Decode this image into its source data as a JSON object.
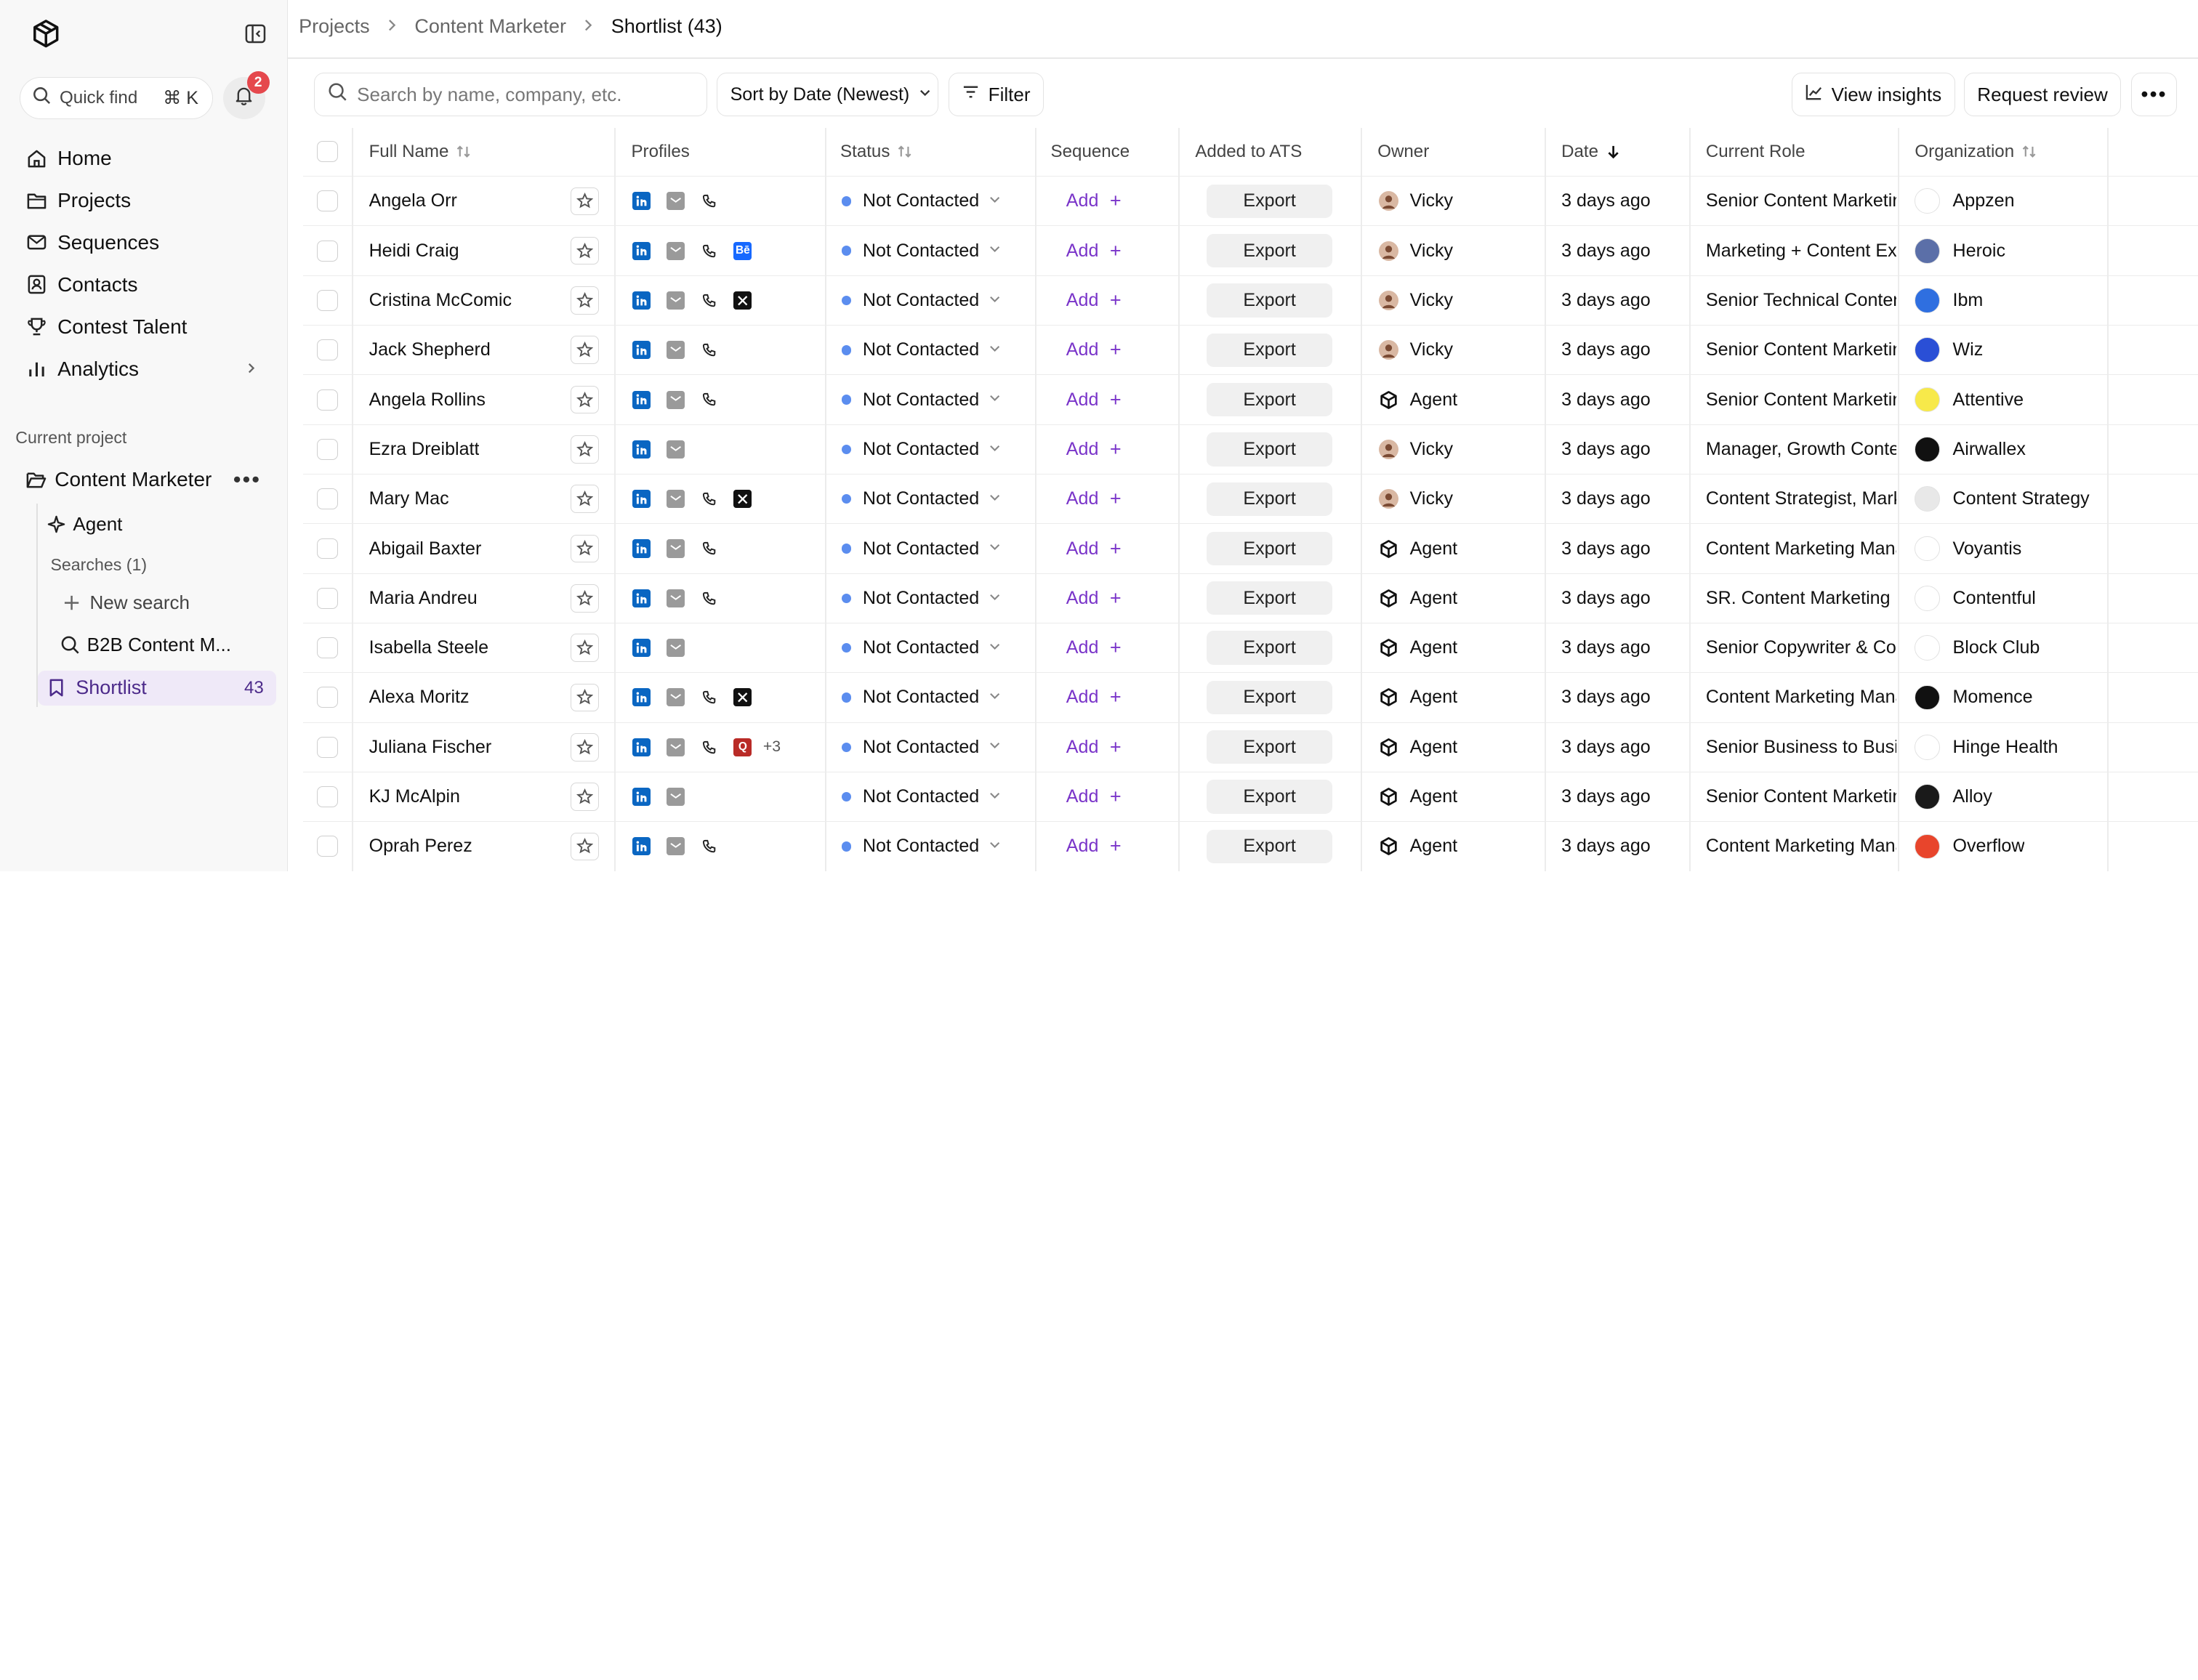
{
  "sidebar": {
    "quickfind_label": "Quick find",
    "quickfind_shortcut": "⌘ K",
    "notification_count": "2",
    "nav": [
      {
        "label": "Home",
        "icon": "home-icon"
      },
      {
        "label": "Projects",
        "icon": "folder-icon"
      },
      {
        "label": "Sequences",
        "icon": "mail-icon"
      },
      {
        "label": "Contacts",
        "icon": "contact-card-icon"
      },
      {
        "label": "Contest Talent",
        "icon": "trophy-icon"
      },
      {
        "label": "Analytics",
        "icon": "bar-chart-icon"
      }
    ],
    "current_project_label": "Current project",
    "project_name": "Content Marketer",
    "agent_label": "Agent",
    "searches_label": "Searches (1)",
    "new_search_label": "New search",
    "search_item_label": "B2B Content M...",
    "shortlist_label": "Shortlist",
    "shortlist_count": "43"
  },
  "breadcrumb": {
    "items": [
      "Projects",
      "Content Marketer"
    ],
    "current": "Shortlist (43)"
  },
  "toolbar": {
    "search_placeholder": "Search by name, company, etc.",
    "sort_label": "Sort by Date (Newest)",
    "filter_label": "Filter",
    "insights_label": "View insights",
    "review_label": "Request review"
  },
  "table": {
    "headers": {
      "full_name": "Full Name",
      "profiles": "Profiles",
      "status": "Status",
      "sequence": "Sequence",
      "added_to_ats": "Added to ATS",
      "owner": "Owner",
      "date": "Date",
      "current_role": "Current Role",
      "organization": "Organization"
    },
    "add_label": "Add",
    "export_label": "Export",
    "rows": [
      {
        "name": "Angela Orr",
        "profiles": [
          "linkedin",
          "mail",
          "phone"
        ],
        "status": "Not Contacted",
        "owner": "Vicky",
        "date": "3 days ago",
        "role": "Senior Content Marketing",
        "org": "Appzen",
        "org_color": "#ffffff"
      },
      {
        "name": "Heidi Craig",
        "profiles": [
          "linkedin",
          "mail",
          "phone",
          "behance"
        ],
        "status": "Not Contacted",
        "owner": "Vicky",
        "date": "3 days ago",
        "role": "Marketing + Content Exp",
        "org": "Heroic",
        "org_color": "#5b6fa8"
      },
      {
        "name": "Cristina McComic",
        "profiles": [
          "linkedin",
          "mail",
          "phone",
          "x"
        ],
        "status": "Not Contacted",
        "owner": "Vicky",
        "date": "3 days ago",
        "role": "Senior Technical Content",
        "org": "Ibm",
        "org_color": "#2f6fe0"
      },
      {
        "name": "Jack Shepherd",
        "profiles": [
          "linkedin",
          "mail",
          "phone"
        ],
        "status": "Not Contacted",
        "owner": "Vicky",
        "date": "3 days ago",
        "role": "Senior Content Marketing",
        "org": "Wiz",
        "org_color": "#2a4fd6"
      },
      {
        "name": "Angela Rollins",
        "profiles": [
          "linkedin",
          "mail",
          "phone"
        ],
        "status": "Not Contacted",
        "owner": "Agent",
        "date": "3 days ago",
        "role": "Senior Content Marketing",
        "org": "Attentive",
        "org_color": "#f7e94a"
      },
      {
        "name": "Ezra Dreiblatt",
        "profiles": [
          "linkedin",
          "mail"
        ],
        "status": "Not Contacted",
        "owner": "Vicky",
        "date": "3 days ago",
        "role": "Manager, Growth Conten",
        "org": "Airwallex",
        "org_color": "#111111"
      },
      {
        "name": "Mary Mac",
        "profiles": [
          "linkedin",
          "mail",
          "phone",
          "x"
        ],
        "status": "Not Contacted",
        "owner": "Vicky",
        "date": "3 days ago",
        "role": "Content Strategist, Marke",
        "org": "Content Strategy",
        "org_color": "#e8e8e8"
      },
      {
        "name": "Abigail Baxter",
        "profiles": [
          "linkedin",
          "mail",
          "phone"
        ],
        "status": "Not Contacted",
        "owner": "Agent",
        "date": "3 days ago",
        "role": "Content Marketing Mana",
        "org": "Voyantis",
        "org_color": "#ffffff"
      },
      {
        "name": "Maria Andreu",
        "profiles": [
          "linkedin",
          "mail",
          "phone"
        ],
        "status": "Not Contacted",
        "owner": "Agent",
        "date": "3 days ago",
        "role": "SR. Content Marketing M",
        "org": "Contentful",
        "org_color": "#ffffff"
      },
      {
        "name": "Isabella Steele",
        "profiles": [
          "linkedin",
          "mail"
        ],
        "status": "Not Contacted",
        "owner": "Agent",
        "date": "3 days ago",
        "role": "Senior Copywriter & Cont",
        "org": "Block Club",
        "org_color": "#ffffff"
      },
      {
        "name": "Alexa Moritz",
        "profiles": [
          "linkedin",
          "mail",
          "phone",
          "x"
        ],
        "status": "Not Contacted",
        "owner": "Agent",
        "date": "3 days ago",
        "role": "Content Marketing Mana",
        "org": "Momence",
        "org_color": "#111111"
      },
      {
        "name": "Juliana Fischer",
        "profiles": [
          "linkedin",
          "mail",
          "phone",
          "quora"
        ],
        "profiles_more": "+3",
        "status": "Not Contacted",
        "owner": "Agent",
        "date": "3 days ago",
        "role": "Senior Business to Busin",
        "org": "Hinge Health",
        "org_color": "#ffffff"
      },
      {
        "name": "KJ McAlpin",
        "profiles": [
          "linkedin",
          "mail"
        ],
        "status": "Not Contacted",
        "owner": "Agent",
        "date": "3 days ago",
        "role": "Senior Content Marketing",
        "org": "Alloy",
        "org_color": "#1a1a1a"
      },
      {
        "name": "Oprah Perez",
        "profiles": [
          "linkedin",
          "mail",
          "phone"
        ],
        "status": "Not Contacted",
        "owner": "Agent",
        "date": "3 days ago",
        "role": "Content Marketing Mana",
        "org": "Overflow",
        "org_color": "#e8452c"
      }
    ]
  },
  "colors": {
    "accent_purple": "#7a35c9",
    "status_blue": "#5b8def",
    "badge_red": "#e5484d",
    "linkedin_blue": "#0a66c2"
  }
}
